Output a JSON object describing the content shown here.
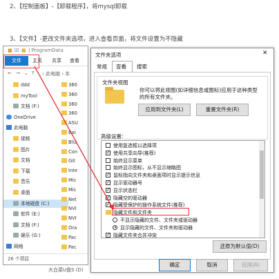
{
  "steps": {
    "step2": "2、【控制面板】-【卸载程序】，将mysql卸载",
    "step3": "3、【文件】-更改文件夹选项，进入查看页面，将文件设置为不隐藏"
  },
  "explorer": {
    "title_path": "| ProgramData",
    "file_tab": "文件",
    "ribbon_tabs": [
      "主页",
      "共享",
      "查看"
    ],
    "nav_path": "› 此电脑 › 本",
    "tree": [
      {
        "label": "ddd",
        "icon": "folder-icon"
      },
      {
        "label": "myTool",
        "icon": "folder-icon"
      },
      {
        "label": "文档 (F:)",
        "icon": "drive-icon"
      },
      {
        "label": "OneDrive",
        "icon": "cloud-icon"
      },
      {
        "label": "此电脑",
        "icon": "pc-icon"
      },
      {
        "label": "视频",
        "icon": "folder-icon"
      },
      {
        "label": "图片",
        "icon": "folder-icon"
      },
      {
        "label": "文档",
        "icon": "folder-icon"
      },
      {
        "label": "下载",
        "icon": "folder-icon"
      },
      {
        "label": "音乐",
        "icon": "folder-icon"
      },
      {
        "label": "桌面",
        "icon": "folder-icon"
      },
      {
        "label": "本地磁盘 (C:)",
        "icon": "drive-icon"
      },
      {
        "label": "软件 (E:)",
        "icon": "drive-icon"
      },
      {
        "label": "文档 (F:)",
        "icon": "drive-icon"
      },
      {
        "label": "娱乐 (G:)",
        "icon": "drive-icon"
      },
      {
        "label": "网络",
        "icon": "network-icon"
      }
    ],
    "list": [
      "360",
      "360",
      "360",
      "360",
      "ASU",
      "Bai",
      "Bliz",
      "Con",
      "Git",
      "Inte",
      "Mic",
      "Mic",
      "Net",
      "NVI",
      "NVI",
      "Ora",
      "Pac",
      "Pac"
    ],
    "status": "26 个项目"
  },
  "dialog": {
    "title": "文件夹选项",
    "close": "✕",
    "tabs": [
      "常规",
      "查看",
      "搜索"
    ],
    "folder_view_label": "文件夹视图",
    "folder_view_desc": "你可以将此视图(如详细信息或图标)应用于这种类型的所有文件夹。",
    "apply_to_folders": "应用到文件夹(L)",
    "reset_folders": "重置文件夹(R)",
    "advanced_label": "高级设置:",
    "advanced": [
      {
        "kind": "cb",
        "on": false,
        "label": "使用复选框以选择项"
      },
      {
        "kind": "cb",
        "on": true,
        "label": "使用共享向导(推荐)"
      },
      {
        "kind": "cb",
        "on": false,
        "label": "始终显示菜单"
      },
      {
        "kind": "cb",
        "on": false,
        "label": "始终显示图标，从不显示缩略图"
      },
      {
        "kind": "cb",
        "on": true,
        "label": "鼠标指向文件夹和桌面项时显示提示信息"
      },
      {
        "kind": "cb",
        "on": true,
        "label": "显示驱动器号"
      },
      {
        "kind": "cb",
        "on": true,
        "label": "显示状态栏"
      },
      {
        "kind": "cb",
        "on": true,
        "label": "隐藏空的驱动器"
      },
      {
        "kind": "cb",
        "on": true,
        "label": "隐藏受保护的操作系统文件(推荐)"
      },
      {
        "kind": "dir",
        "on": false,
        "label": "隐藏文件和文件夹"
      },
      {
        "kind": "rd",
        "on": false,
        "label": "不显示隐藏的文件、文件夹或驱动器"
      },
      {
        "kind": "rd",
        "on": true,
        "label": "显示隐藏的文件、文件夹和驱动器"
      },
      {
        "kind": "cb",
        "on": true,
        "label": "隐藏文件夹合并冲突"
      }
    ],
    "restore_defaults": "还原为默认值(D)",
    "ok": "确定",
    "cancel": "取消",
    "apply": "应用(A)"
  },
  "watermark": "大白菜U盘S (D)",
  "colors": {
    "accent": "#1979ca",
    "highlight": "#e33333"
  }
}
